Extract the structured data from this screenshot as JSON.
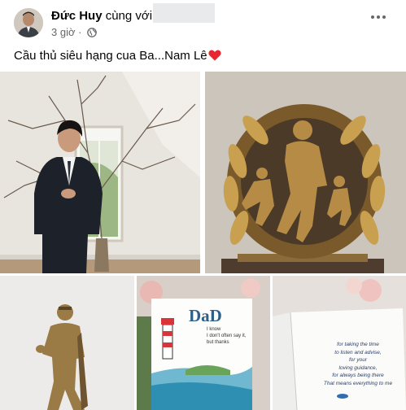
{
  "post": {
    "author": "Đức Huy",
    "with_text": "cùng với",
    "time": "3 giờ",
    "dot": "·",
    "caption": "Cầu thủ siêu hạng cua Ba...Nam Lê"
  },
  "photos": {
    "card_dad_title": "DaD",
    "card_dad_line1": "I know",
    "card_dad_line2": "I don't often say it,",
    "card_dad_line3": "but thanks",
    "card_inside_line1": "for taking the time",
    "card_inside_line2": "to listen and advise,",
    "card_inside_line3": "for your",
    "card_inside_line4": "loving guidance,",
    "card_inside_line5": "for always being there",
    "card_inside_line6": "That means everything to me"
  },
  "icons": {
    "globe": "globe-icon",
    "more": "more-options-icon",
    "heart": "red-heart-emoji"
  },
  "colors": {
    "secondary_text": "#65676b",
    "heart": "#e8262f"
  }
}
